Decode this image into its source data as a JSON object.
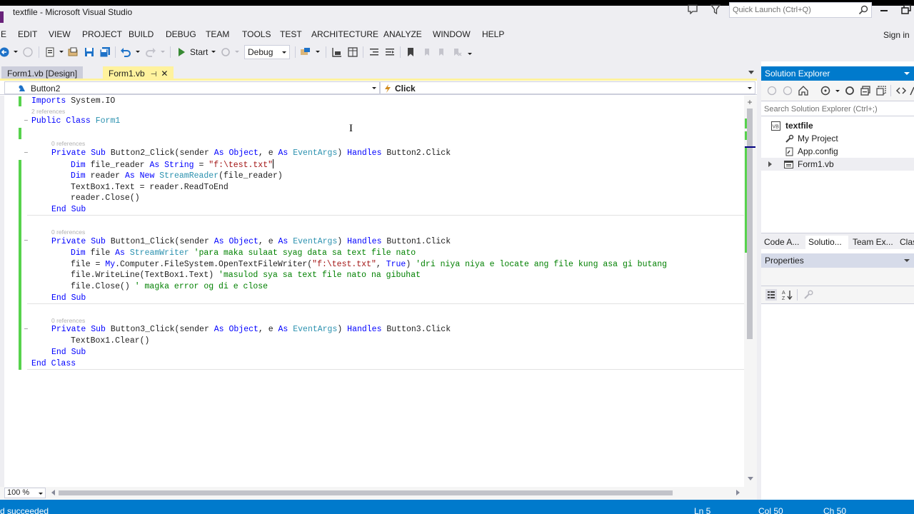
{
  "window": {
    "title": "textfile - Microsoft Visual Studio",
    "quick_launch_placeholder": "Quick Launch (Ctrl+Q)",
    "sign_in": "Sign in",
    "accent_color": "#007acc"
  },
  "menu": [
    "E",
    "EDIT",
    "VIEW",
    "PROJECT",
    "BUILD",
    "DEBUG",
    "TEAM",
    "TOOLS",
    "TEST",
    "ARCHITECTURE",
    "ANALYZE",
    "WINDOW",
    "HELP"
  ],
  "toolbar": {
    "start_label": "Start",
    "configuration": "Debug"
  },
  "editor": {
    "tabs": [
      {
        "label": "Form1.vb [Design]",
        "active": false
      },
      {
        "label": "Form1.vb",
        "active": true
      }
    ],
    "nav_left": "Button2",
    "nav_right": "Click",
    "zoom": "100 %",
    "codelens": {
      "class_refs": "2 references",
      "button2_refs": "0 references",
      "button1_refs": "0 references",
      "button3_refs": "0 references"
    },
    "code": {
      "l_imports": {
        "kw": "Imports",
        "rest": " System.IO"
      },
      "l_class": {
        "kw1": "Public",
        "kw2": "Class",
        "name": "Form1"
      },
      "l_b2_sig": {
        "p1": "Private",
        "p2": "Sub",
        "p3": " Button2_Click(sender ",
        "p4": "As",
        "p5": "Object",
        "p6": ", e ",
        "p7": "As",
        "p8": "EventArgs",
        "p9": ") ",
        "p10": "Handles",
        "p11": " Button2.Click"
      },
      "l_b2_1": {
        "dim": "Dim",
        "name": " file_reader ",
        "as": "As",
        "type": "String",
        "eq": " = ",
        "str": "\"f:\\test.txt\""
      },
      "l_b2_2": {
        "dim": "Dim",
        "name": " reader ",
        "as": "As",
        "new": "New",
        "type": "StreamReader",
        "rest": "(file_reader)"
      },
      "l_b2_3": "TextBox1.Text = reader.ReadToEnd",
      "l_b2_4": "reader.Close()",
      "l_endsub": {
        "end": "End",
        "sub": "Sub"
      },
      "l_b1_sig": {
        "p1": "Private",
        "p2": "Sub",
        "p3": " Button1_Click(sender ",
        "p4": "As",
        "p5": "Object",
        "p6": ", e ",
        "p7": "As",
        "p8": "EventArgs",
        "p9": ") ",
        "p10": "Handles",
        "p11": " Button1.Click"
      },
      "l_b1_1": {
        "dim": "Dim",
        "name": " file ",
        "as": "As",
        "type": "StreamWriter",
        "comment": "'para maka sulaat syag data sa text file nato"
      },
      "l_b1_2": {
        "pre": "file = ",
        "my": "My",
        "mid": ".Computer.FileSystem.OpenTextFileWriter(",
        "str": "\"f:\\test.txt\"",
        "sep": ", ",
        "true": "True",
        "close": ") ",
        "comment": "'dri niya niya e locate ang file kung asa gi butang"
      },
      "l_b1_3": {
        "code": "file.WriteLine(TextBox1.Text) ",
        "comment": "'masulod sya sa text file nato na gibuhat"
      },
      "l_b1_4": {
        "code": "file.Close() ",
        "comment": "' magka error og di e close"
      },
      "l_b3_sig": {
        "p1": "Private",
        "p2": "Sub",
        "p3": " Button3_Click(sender ",
        "p4": "As",
        "p5": "Object",
        "p6": ", e ",
        "p7": "As",
        "p8": "EventArgs",
        "p9": ") ",
        "p10": "Handles",
        "p11": " Button3.Click"
      },
      "l_b3_1": "TextBox1.Clear()",
      "l_endclass": {
        "end": "End",
        "class": "Class"
      }
    }
  },
  "solution_explorer": {
    "title": "Solution Explorer",
    "search_placeholder": "Search Solution Explorer (Ctrl+;)",
    "items": [
      {
        "label": "textfile",
        "icon": "vb-project-icon"
      },
      {
        "label": "My Project",
        "icon": "wrench-icon"
      },
      {
        "label": "App.config",
        "icon": "config-file-icon"
      },
      {
        "label": "Form1.vb",
        "icon": "form-icon"
      }
    ],
    "tabs": [
      "Code A...",
      "Solutio...",
      "Team Ex...",
      "Clas"
    ]
  },
  "properties": {
    "title": "Properties"
  },
  "status": {
    "message": "d succeeded",
    "ln": "Ln 5",
    "col": "Col 50",
    "ch": "Ch 50"
  }
}
